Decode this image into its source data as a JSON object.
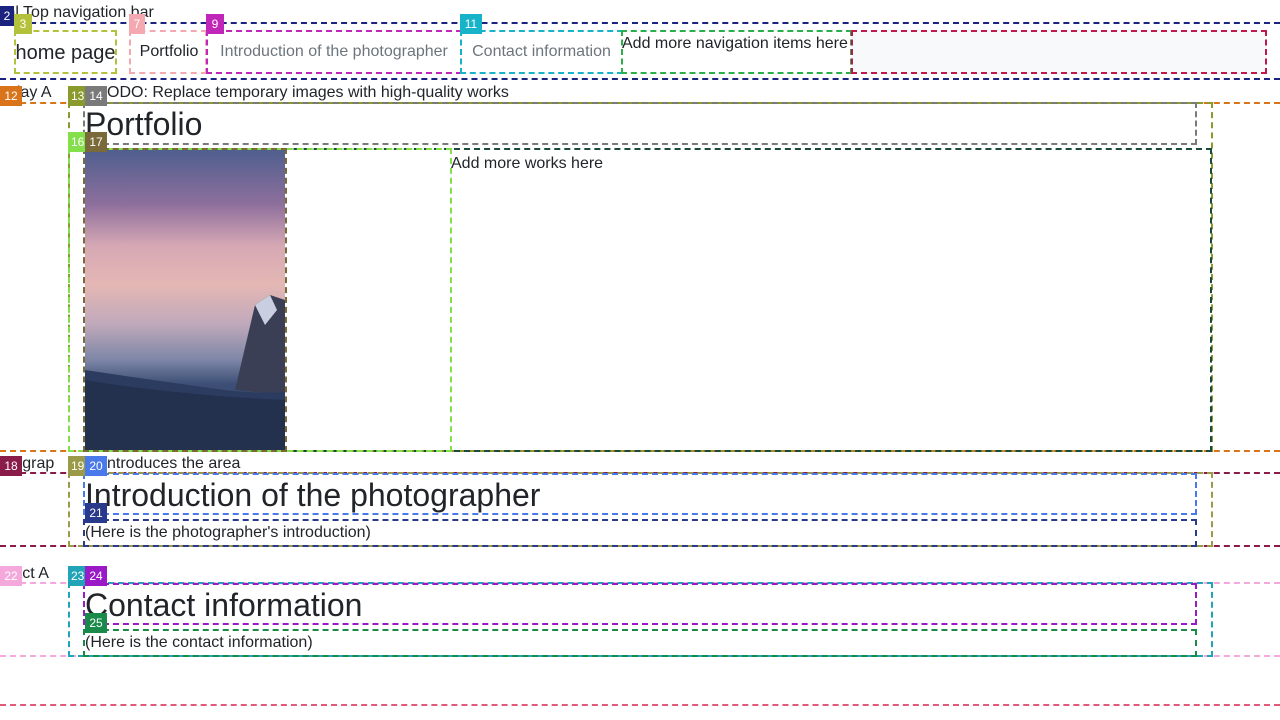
{
  "comments": {
    "nav": "ml Top navigation bar",
    "display": "splay A",
    "todo": "ODO: Replace temporary images with high-quality works",
    "photog": "otograp",
    "intro": "ntroduces the area",
    "contact": "ntact A"
  },
  "nav": {
    "home": "home page",
    "portfolio": "Portfolio",
    "introduction": "Introduction of the photographer",
    "contact": "Contact information",
    "more": "Add more navigation items here"
  },
  "portfolio": {
    "title": "Portfolio",
    "more_works": "Add more works here"
  },
  "photographer": {
    "title": "Introduction of the photographer",
    "text": "(Here is the photographer's introduction)"
  },
  "contact": {
    "title": "Contact information",
    "text": "(Here is the contact information)"
  },
  "badges": [
    "2",
    "3",
    "7",
    "9",
    "11",
    "12",
    "13",
    "14",
    "16",
    "17",
    "18",
    "19",
    "20",
    "21",
    "22",
    "23",
    "24",
    "25"
  ],
  "colors": {
    "b2": "#1a237e",
    "b3": "#b3c23a",
    "b7": "#f4a8b0",
    "b9": "#c026b8",
    "b11": "#17b3c9",
    "b12": "#d9741a",
    "b13": "#8a9a2c",
    "b14": "#7a7a7a",
    "b16": "#84e04a",
    "b17": "#7a6a3a",
    "b18": "#8a1c4a",
    "b19": "#9a9a48",
    "b20": "#4a7aea",
    "b21": "#2a3a8a",
    "b22": "#f4a8dc",
    "b23": "#21a3b8",
    "b24": "#9a1ac8",
    "b25": "#1a8a4a"
  }
}
